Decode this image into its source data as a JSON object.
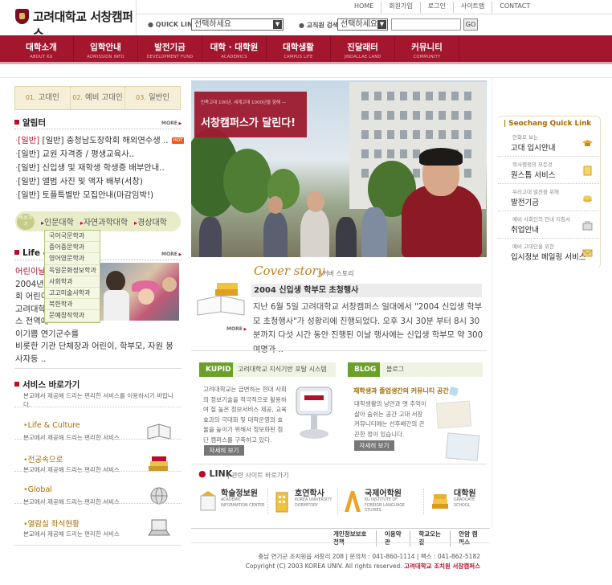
{
  "header": {
    "logo_text": "고려대학교 서창캠퍼스",
    "util_links": [
      "HOME",
      "회원가입",
      "로그인",
      "사이트맵",
      "CONTACT"
    ],
    "quick_link_label": "QUICK LINK",
    "quick_link_select": "선택하세요",
    "search_label": "교직원 검색",
    "search_select": "선택하세요",
    "search_button": "GO"
  },
  "nav": [
    {
      "ko": "대학소개",
      "en": "ABOUT KU"
    },
    {
      "ko": "입학안내",
      "en": "ADMISSION INFO"
    },
    {
      "ko": "발전기금",
      "en": "DEVELOPMENT FUND"
    },
    {
      "ko": "대학 · 대학원",
      "en": "ACADEMICS"
    },
    {
      "ko": "대학생활",
      "en": "CAMPUS LIFE"
    },
    {
      "ko": "진달래터",
      "en": "JINDALLAE LAND"
    },
    {
      "ko": "커뮤니티",
      "en": "COMMUNITY"
    }
  ],
  "tabs": [
    {
      "num": "01.",
      "label": "고대인"
    },
    {
      "num": "02.",
      "label": "예비 고대인"
    },
    {
      "num": "03.",
      "label": "일반인"
    }
  ],
  "notice": {
    "title": "알림터",
    "more": "MORE",
    "hot": "HOT",
    "items": [
      "[일반] 충청남도장학회 해외연수생 ..",
      "[일반] 교원 자격증 / 평생교육사..",
      "[일반] 신입생 및 재학생 학생증 배부안내..",
      "[일반] 앨범 사진 및 액자 배부(서창)",
      "[일반] 토플특별반 모집안내(마감임박!)"
    ]
  },
  "college_bar": {
    "badge": "바로가기",
    "colleges": [
      "인문대학",
      "자연과학대학",
      "경상대학"
    ],
    "dropdown": [
      "국어국문학과",
      "중어중문학과",
      "영어영문학과",
      "독일문화정보학과",
      "사회학과",
      "고고미술사학과",
      "북한학과",
      "문예창작학과"
    ]
  },
  "life": {
    "title": "Life &",
    "more": "MORE",
    "headline": "어린이날",
    "lines": [
      "2004년 5",
      "회 어린이",
      "고려대학",
      "스 전역에",
      "이기쁨 연기군수를"
    ],
    "tail": "비롯한 기관 단체장과 어린이, 학부모, 자원 봉사자등 .."
  },
  "services": {
    "title": "서비스 바로가기",
    "desc": "본교에서 제공해 드리는 편리한 서비스를 이용하시기 바랍니다.",
    "items": [
      {
        "title": "Life & Culture",
        "desc": "본교에서 제공해 드리는 편리한 서비스"
      },
      {
        "title": "전공속으로",
        "desc": "본교에서 제공해 드리는 편리한 서비스"
      },
      {
        "title": "Global",
        "desc": "본교에서 제공해 드리는 편리한 서비스"
      },
      {
        "title": "열람실 좌석현황",
        "desc": "본교에서 제공해 드리는 편리한 서비스"
      }
    ]
  },
  "hero": {
    "small": "민족고대 100년, 세계고대 1000년을 향해 —",
    "big": "서창캠퍼스가 달린다!"
  },
  "cover": {
    "title": "Cover story",
    "subtitle": "커버 스토리",
    "headline": "2004 신입생 학부모 초청행사",
    "body": "지난 6월 5일 고려대학교 서창캠퍼스 일대에서 \"2004 신입생 학부모 초청행사\"가 성황리에 진행되었다. 오후 3시 30분 부터 8시 30분까지 다섯 시간 동안 진행된 이날 행사에는 신입생 학부모 약 300여명과 ..",
    "more": "MORE"
  },
  "kupid": {
    "label": "KUPID",
    "desc_title": "고려대학교 지식기반 포탈 시스템",
    "body": "고려대학교는 급변하는 현대 사회의 정보기술을 적극적으로 활용하여 질 높은 정보서비스 제공, 교육 효과의 극대화 및 대학운영의 효율을 높이기 위해서 정보화된 첨단 캠퍼스를 구축하고 있다.",
    "button": "자세히 보기"
  },
  "blog": {
    "label": "BLOG",
    "desc_title": "블로그",
    "headline": "재학생과 졸업생간의 커뮤니티 공간",
    "body": "대학생활의 낭만과 옛 추억이 살아 숨쉬는 공간 고대 서창 커뮤니티에는 선후배간의 끈끈한 정이 있습니다.",
    "button": "자세히 보기"
  },
  "links": {
    "title": "LINK",
    "subtitle": "관련 사이트 바로가기",
    "items": [
      {
        "ko": "학술정보원",
        "en": "ACADEMIC INFORMATION CENTER"
      },
      {
        "ko": "호연학사",
        "en": "KOREA UNIVERSITY DORMITORY"
      },
      {
        "ko": "국제어학원",
        "en": "KU INSTITUTE OF FOREIGN LANGUAGE STUDIES"
      },
      {
        "ko": "대학원",
        "en": "GRADUATE SCHOOL"
      }
    ]
  },
  "quick": {
    "title": "Seochang Quick Link",
    "items": [
      {
        "small": "안화로 보는",
        "big": "고대 입시안내"
      },
      {
        "small": "학사행정의 모든것",
        "big": "원스톱 서비스"
      },
      {
        "small": "우리고대 발전을 위해",
        "big": "발전기금"
      },
      {
        "small": "예비 사회인의 안내 지침서",
        "big": "취업안내"
      },
      {
        "small": "예비 고대인을 위한",
        "big": "입시정보 메일링 서비스"
      }
    ]
  },
  "footer": {
    "links": [
      "개인정보보호정책",
      "이용약관",
      "학교오는 길",
      "안암 캠퍼스"
    ],
    "address": "충남 연기군 조치원읍 서창리 208 | 문의처 : 041-860-1114 | 팩스 : 041-862-5182",
    "copyright": "Copyright (C) 2003 KOREA UNIV. All rights reserved.",
    "copyright_red": "고려대학교 조치원 서창캠퍼스"
  }
}
